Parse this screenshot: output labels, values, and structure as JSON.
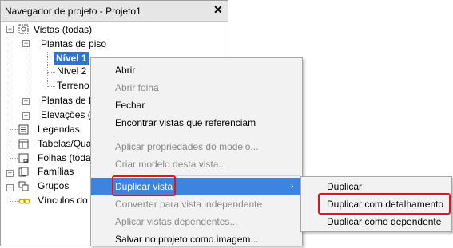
{
  "panel": {
    "title": "Navegador de projeto - Projeto1",
    "close_label": "✕"
  },
  "tree": {
    "views_all": "Vistas (todas)",
    "floor_plans": "Plantas de piso",
    "level1": "Nível 1",
    "level2": "Nível 2",
    "terrain": "Terreno",
    "ceiling_plans": "Plantas de f",
    "elevations": "Elevações (",
    "legends": "Legendas",
    "schedules": "Tabelas/Qua",
    "sheets": "Folhas (toda",
    "families": "Famílias",
    "groups": "Grupos",
    "links": "Vínculos do"
  },
  "context_menu": {
    "open": "Abrir",
    "open_sheet": "Abrir folha",
    "close": "Fechar",
    "find_views": "Encontrar vistas que referenciam",
    "apply_template": "Aplicar propriedades do modelo...",
    "create_template": "Criar modelo desta vista...",
    "duplicate_view": "Duplicar vista",
    "convert_independent": "Converter para vista independente",
    "apply_dependents": "Aplicar vistas dependentes...",
    "save_image": "Salvar no projeto como imagem...",
    "submenu_arrow": "›"
  },
  "submenu": {
    "duplicate": "Duplicar",
    "duplicate_detailing": "Duplicar com detalhamento",
    "duplicate_dependent": "Duplicar como dependente"
  },
  "colors": {
    "highlight": "#3c84e0",
    "selection": "#3074d0",
    "annotation_red": "#e0141e"
  }
}
